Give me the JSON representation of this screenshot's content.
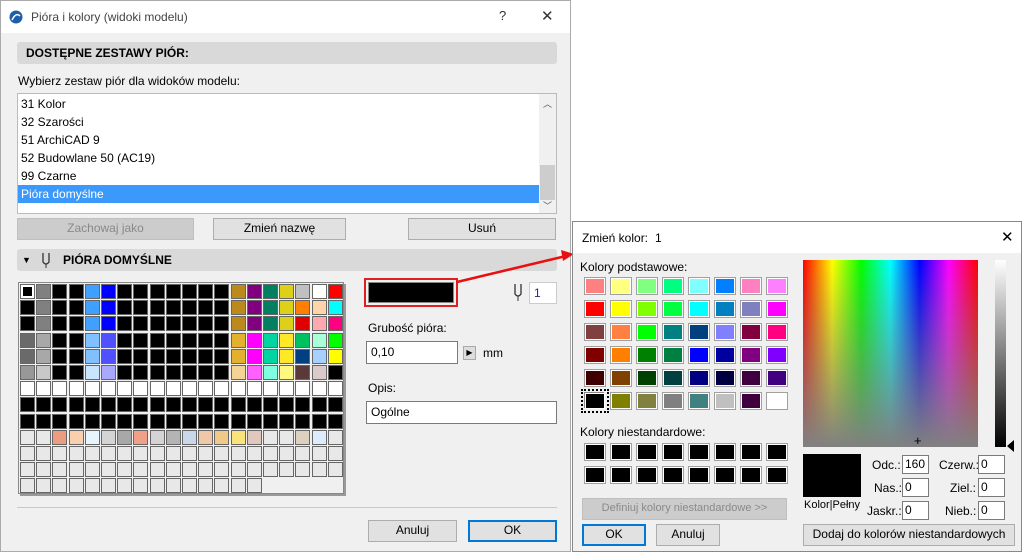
{
  "main_dialog": {
    "title": "Pióra i kolory (widoki modelu)",
    "help": "?",
    "close": "✕",
    "sets_header": "DOSTĘPNE ZESTAWY PIÓR:",
    "sets_label": "Wybierz zestaw piór dla widoków modelu:",
    "sets": [
      {
        "label": "31 Kolor"
      },
      {
        "label": "32 Szarości"
      },
      {
        "label": "51 ArchiCAD 9"
      },
      {
        "label": "52 Budowlane 50 (AC19)"
      },
      {
        "label": "99 Czarne"
      },
      {
        "label": "Pióra domyślne",
        "selected": true
      }
    ],
    "save_as": "Zachowaj jako",
    "rename": "Zmień nazwę",
    "delete": "Usuń",
    "pens_header": "PIÓRA DOMYŚLNE",
    "pen_number": "1",
    "pen_color": "#000000",
    "weight_label": "Grubość pióra:",
    "weight_value": "0,10",
    "weight_unit": "mm",
    "desc_label": "Opis:",
    "desc_value": "Ogólne",
    "cancel": "Anuluj",
    "ok": "OK",
    "pen_grid": [
      [
        "#000000",
        "#808080",
        "#000000",
        "#000000",
        "#3fa0ff",
        "#0000ff",
        "#000000",
        "#000000",
        "#000000",
        "#000000",
        "#000000",
        "#000000",
        "#000000",
        "#bc8a1c",
        "#800080",
        "#008060",
        "#dcd018",
        "#c0c0c0",
        "#ffffff",
        "#ff0000"
      ],
      [
        "#000000",
        "#808080",
        "#000000",
        "#000000",
        "#3fa0ff",
        "#0000ff",
        "#000000",
        "#000000",
        "#000000",
        "#000000",
        "#000000",
        "#000000",
        "#000000",
        "#bc8a1c",
        "#800080",
        "#008060",
        "#dcd018",
        "#ff8000",
        "#ffd4a8",
        "#00ffff"
      ],
      [
        "#000000",
        "#808080",
        "#000000",
        "#000000",
        "#3fa0ff",
        "#0000ff",
        "#000000",
        "#000000",
        "#000000",
        "#000000",
        "#000000",
        "#000000",
        "#000000",
        "#bc8a1c",
        "#800080",
        "#008060",
        "#dcd018",
        "#e00000",
        "#ffa8b0",
        "#ff0080"
      ],
      [
        "#6a6a6a",
        "#a8a8a8",
        "#000000",
        "#000000",
        "#80c0ff",
        "#5050ff",
        "#000000",
        "#000000",
        "#000000",
        "#000000",
        "#000000",
        "#000000",
        "#000000",
        "#e4b030",
        "#ff00ff",
        "#00d4a0",
        "#ffe828",
        "#00c060",
        "#a8ffd8",
        "#00ff00"
      ],
      [
        "#6a6a6a",
        "#a8a8a8",
        "#000000",
        "#000000",
        "#80c0ff",
        "#5050ff",
        "#000000",
        "#000000",
        "#000000",
        "#000000",
        "#000000",
        "#000000",
        "#000000",
        "#e4b030",
        "#ff00ff",
        "#00d4a0",
        "#ffe828",
        "#004080",
        "#a8d0ff",
        "#ffff00"
      ],
      [
        "#989898",
        "#c8c8c8",
        "#000000",
        "#000000",
        "#c8e4ff",
        "#a8a8ff",
        "#000000",
        "#000000",
        "#000000",
        "#000000",
        "#000000",
        "#000000",
        "#000000",
        "#f4d494",
        "#ff60ff",
        "#80ffe0",
        "#fff880",
        "#5a3a38",
        "#dccaca",
        "#000000"
      ],
      [
        "#ffffff",
        "#ffffff",
        "#ffffff",
        "#ffffff",
        "#ffffff",
        "#ffffff",
        "#ffffff",
        "#ffffff",
        "#ffffff",
        "#ffffff",
        "#ffffff",
        "#ffffff",
        "#ffffff",
        "#ffffff",
        "#ffffff",
        "#ffffff",
        "#ffffff",
        "#ffffff",
        "#ffffff",
        "#ffffff"
      ],
      [
        "#000000",
        "#000000",
        "#000000",
        "#000000",
        "#000000",
        "#000000",
        "#000000",
        "#000000",
        "#000000",
        "#000000",
        "#000000",
        "#000000",
        "#000000",
        "#000000",
        "#000000",
        "#000000",
        "#000000",
        "#000000",
        "#000000",
        "#000000"
      ],
      [
        "#000000",
        "#000000",
        "#000000",
        "#000000",
        "#000000",
        "#000000",
        "#000000",
        "#000000",
        "#000000",
        "#000000",
        "#000000",
        "#000000",
        "#000000",
        "#000000",
        "#000000",
        "#000000",
        "#000000",
        "#000000",
        "#000000",
        "#000000"
      ],
      [
        "#e8e8e8",
        "#e8e8e8",
        "#ec9c80",
        "#f8d0b0",
        "#e8f4fc",
        "#d4d4d4",
        "#a8a8a8",
        "#f0a088",
        "#d4d4d4",
        "#b4b4b4",
        "#c8d8e8",
        "#f0c8a8",
        "#f0c888",
        "#f8e478",
        "#e0c8bc",
        "#e8e8e8",
        "#e8e8e8",
        "#dcd0c0",
        "#dcecfc",
        "#e8e8e8"
      ],
      [
        "#e8e8e8",
        "#e8e8e8",
        "#e8e8e8",
        "#e8e8e8",
        "#e8e8e8",
        "#e8e8e8",
        "#e8e8e8",
        "#e8e8e8",
        "#e8e8e8",
        "#e8e8e8",
        "#e8e8e8",
        "#e8e8e8",
        "#e8e8e8",
        "#e8e8e8",
        "#e8e8e8",
        "#e8e8e8",
        "#e8e8e8",
        "#e8e8e8",
        "#e8e8e8",
        "#e8e8e8"
      ],
      [
        "#e8e8e8",
        "#e8e8e8",
        "#e8e8e8",
        "#e8e8e8",
        "#e8e8e8",
        "#e8e8e8",
        "#e8e8e8",
        "#e8e8e8",
        "#e8e8e8",
        "#e8e8e8",
        "#e8e8e8",
        "#e8e8e8",
        "#e8e8e8",
        "#e8e8e8",
        "#e8e8e8",
        "#e8e8e8",
        "#e8e8e8",
        "#e8e8e8",
        "#e8e8e8",
        "#e8e8e8"
      ],
      [
        "#e8e8e8",
        "#e8e8e8",
        "#e8e8e8",
        "#e8e8e8",
        "#e8e8e8",
        "#e8e8e8",
        "#e8e8e8",
        "#e8e8e8",
        "#e8e8e8",
        "#e8e8e8",
        "#e8e8e8",
        "#e8e8e8",
        "#e8e8e8",
        "#e8e8e8",
        "#e8e8e8"
      ]
    ]
  },
  "color_dialog": {
    "title": "Zmień kolor:",
    "title_number": "1",
    "close": "✕",
    "basic_label": "Kolory podstawowe:",
    "basic_colors": [
      "#ff8080",
      "#ffff80",
      "#80ff80",
      "#00ff80",
      "#80ffff",
      "#0080ff",
      "#ff80c0",
      "#ff80ff",
      "#ff0000",
      "#ffff00",
      "#80ff00",
      "#00ff40",
      "#00ffff",
      "#0080c0",
      "#8080c0",
      "#ff00ff",
      "#804040",
      "#ff8040",
      "#00ff00",
      "#008080",
      "#004080",
      "#8080ff",
      "#800040",
      "#ff0080",
      "#800000",
      "#ff8000",
      "#008000",
      "#008040",
      "#0000ff",
      "#0000a0",
      "#800080",
      "#8000ff",
      "#400000",
      "#804000",
      "#004000",
      "#004040",
      "#000080",
      "#000040",
      "#400040",
      "#400080",
      "#000000",
      "#808000",
      "#808040",
      "#808080",
      "#408080",
      "#c0c0c0",
      "#400040",
      "#ffffff"
    ],
    "custom_label": "Kolory niestandardowe:",
    "define_custom": "Definiuj kolory niestandardowe >>",
    "ok": "OK",
    "cancel": "Anuluj",
    "preview_label": "Kolor|Pełny",
    "hue_label": "Odc.:",
    "hue": "160",
    "sat_label": "Nas.:",
    "sat": "0",
    "lum_label": "Jaskr.:",
    "lum": "0",
    "red_label": "Czerw.:",
    "red": "0",
    "green_label": "Ziel.:",
    "green": "0",
    "blue_label": "Nieb.:",
    "blue": "0",
    "add_custom": "Dodaj do kolorów niestandardowych"
  }
}
